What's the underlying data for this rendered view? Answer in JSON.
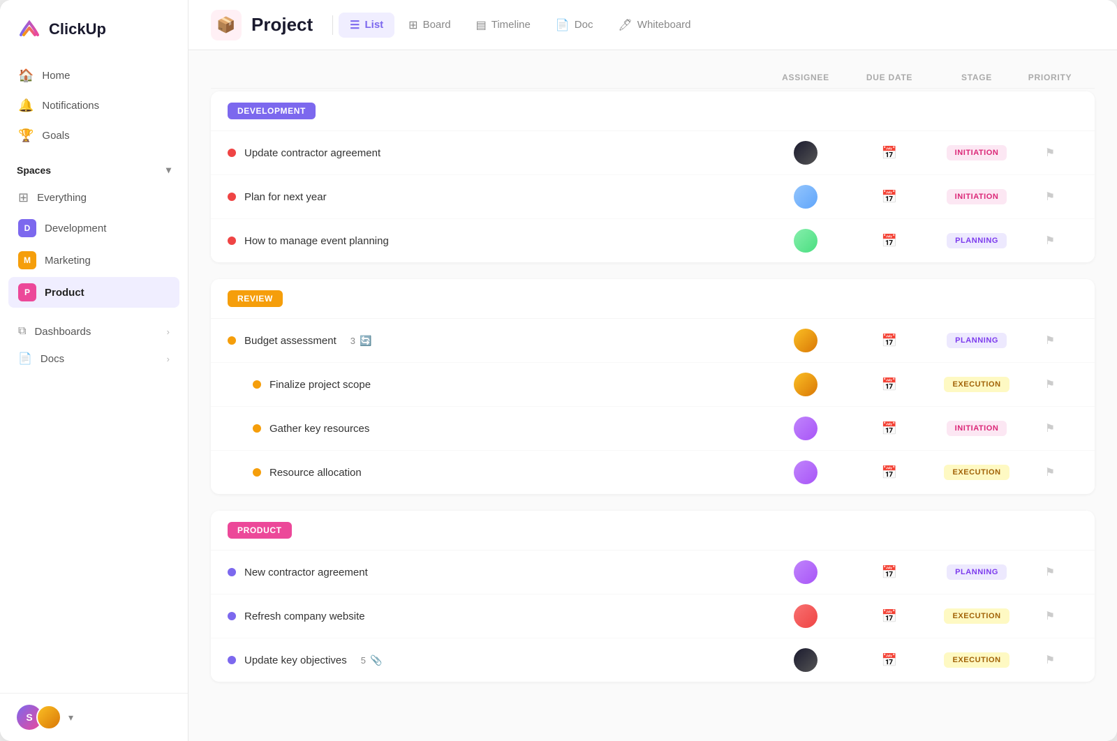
{
  "app": {
    "name": "ClickUp"
  },
  "sidebar": {
    "nav_items": [
      {
        "id": "home",
        "label": "Home",
        "icon": "🏠"
      },
      {
        "id": "notifications",
        "label": "Notifications",
        "icon": "🔔"
      },
      {
        "id": "goals",
        "label": "Goals",
        "icon": "🏆"
      }
    ],
    "spaces_label": "Spaces",
    "spaces": [
      {
        "id": "everything",
        "label": "Everything",
        "type": "everything"
      },
      {
        "id": "development",
        "label": "Development",
        "badge": "D",
        "badge_class": "d"
      },
      {
        "id": "marketing",
        "label": "Marketing",
        "badge": "M",
        "badge_class": "m"
      },
      {
        "id": "product",
        "label": "Product",
        "badge": "P",
        "badge_class": "p",
        "active": true
      }
    ],
    "sub_items": [
      {
        "id": "dashboards",
        "label": "Dashboards"
      },
      {
        "id": "docs",
        "label": "Docs"
      }
    ],
    "footer": {
      "avatar_label": "S",
      "chevron": "▾"
    }
  },
  "header": {
    "project_icon": "📦",
    "title": "Project",
    "tabs": [
      {
        "id": "list",
        "label": "List",
        "icon": "☰",
        "active": true
      },
      {
        "id": "board",
        "label": "Board",
        "icon": "⊞"
      },
      {
        "id": "timeline",
        "label": "Timeline",
        "icon": "▤"
      },
      {
        "id": "doc",
        "label": "Doc",
        "icon": "📄"
      },
      {
        "id": "whiteboard",
        "label": "Whiteboard",
        "icon": "🖊"
      }
    ]
  },
  "columns": {
    "assignee": "ASSIGNEE",
    "due_date": "DUE DATE",
    "stage": "STAGE",
    "priority": "PRIORITY"
  },
  "sections": [
    {
      "id": "development",
      "label": "DEVELOPMENT",
      "badge_class": "development",
      "tasks": [
        {
          "id": "t1",
          "name": "Update contractor agreement",
          "dot": "red",
          "assignee_class": "av1",
          "stage": "INITIATION",
          "stage_class": "initiation",
          "sub": false
        },
        {
          "id": "t2",
          "name": "Plan for next year",
          "dot": "red",
          "assignee_class": "av2",
          "stage": "INITIATION",
          "stage_class": "initiation",
          "sub": false
        },
        {
          "id": "t3",
          "name": "How to manage event planning",
          "dot": "red",
          "assignee_class": "av3",
          "stage": "PLANNING",
          "stage_class": "planning",
          "sub": false
        }
      ]
    },
    {
      "id": "review",
      "label": "REVIEW",
      "badge_class": "review",
      "tasks": [
        {
          "id": "t4",
          "name": "Budget assessment",
          "dot": "yellow",
          "assignee_class": "av4",
          "stage": "PLANNING",
          "stage_class": "planning",
          "sub": false,
          "count": "3",
          "has_refresh": true
        },
        {
          "id": "t5",
          "name": "Finalize project scope",
          "dot": "yellow",
          "assignee_class": "av4",
          "stage": "EXECUTION",
          "stage_class": "execution",
          "sub": true
        },
        {
          "id": "t6",
          "name": "Gather key resources",
          "dot": "yellow",
          "assignee_class": "av5",
          "stage": "INITIATION",
          "stage_class": "initiation",
          "sub": true
        },
        {
          "id": "t7",
          "name": "Resource allocation",
          "dot": "yellow",
          "assignee_class": "av5",
          "stage": "EXECUTION",
          "stage_class": "execution",
          "sub": true
        }
      ]
    },
    {
      "id": "product",
      "label": "PRODUCT",
      "badge_class": "product",
      "tasks": [
        {
          "id": "t8",
          "name": "New contractor agreement",
          "dot": "purple",
          "assignee_class": "av5",
          "stage": "PLANNING",
          "stage_class": "planning",
          "sub": false
        },
        {
          "id": "t9",
          "name": "Refresh company website",
          "dot": "purple",
          "assignee_class": "av6",
          "stage": "EXECUTION",
          "stage_class": "execution",
          "sub": false
        },
        {
          "id": "t10",
          "name": "Update key objectives",
          "dot": "purple",
          "assignee_class": "av1",
          "stage": "EXECUTION",
          "stage_class": "execution",
          "sub": false,
          "count": "5",
          "has_attachment": true
        }
      ]
    }
  ]
}
